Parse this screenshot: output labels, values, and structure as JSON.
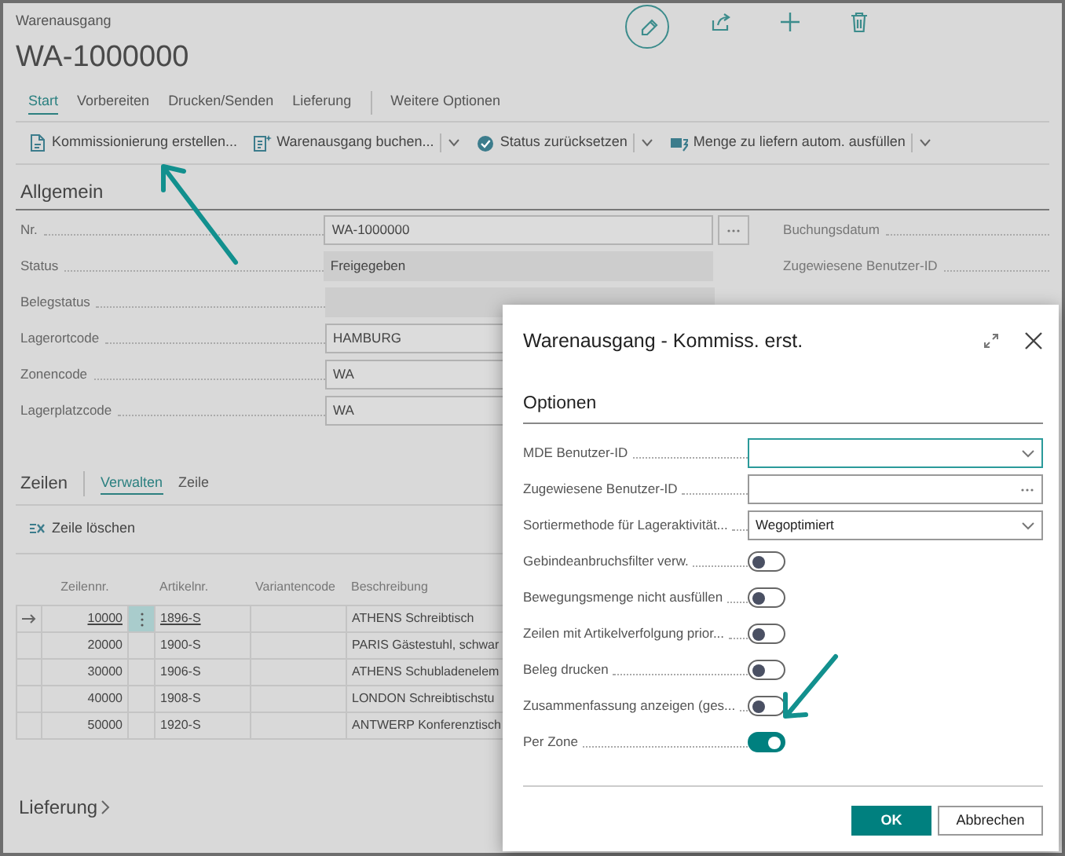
{
  "page": {
    "breadcrumb": "Warenausgang",
    "title": "WA-1000000"
  },
  "tabs": [
    {
      "label": "Start",
      "selected": true
    },
    {
      "label": "Vorbereiten",
      "selected": false
    },
    {
      "label": "Drucken/Senden",
      "selected": false
    },
    {
      "label": "Lieferung",
      "selected": false
    },
    {
      "label": "Weitere Optionen",
      "selected": false
    }
  ],
  "actions": [
    {
      "label": "Kommissionierung erstellen...",
      "dropdown": false
    },
    {
      "label": "Warenausgang buchen...",
      "dropdown": true
    },
    {
      "label": "Status zurücksetzen",
      "dropdown": true
    },
    {
      "label": "Menge zu liefern autom. ausfüllen",
      "dropdown": true
    }
  ],
  "general": {
    "heading": "Allgemein",
    "fields": [
      {
        "label": "Nr.",
        "value": "WA-1000000",
        "kind": "lookup"
      },
      {
        "label": "Status",
        "value": "Freigegeben",
        "kind": "readonly"
      },
      {
        "label": "Belegstatus",
        "kind": "readonly"
      },
      {
        "label": "Lagerortcode",
        "value": "HAMBURG",
        "kind": "input"
      },
      {
        "label": "Zonencode",
        "value": "WA",
        "kind": "input"
      },
      {
        "label": "Lagerplatzcode",
        "value": "WA",
        "kind": "input"
      }
    ],
    "right_fields": [
      {
        "label": "Buchungsdatum"
      },
      {
        "label": "Zugewiesene Benutzer-ID"
      }
    ]
  },
  "lines": {
    "heading": "Zeilen",
    "tabs": [
      {
        "label": "Verwalten",
        "selected": true
      },
      {
        "label": "Zeile",
        "selected": false
      }
    ],
    "action": "Zeile löschen",
    "columns": [
      "Zeilennr.",
      "Artikelnr.",
      "Variantencode",
      "Beschreibung"
    ],
    "rows": [
      {
        "line_no": "10000",
        "item_no": "1896-S",
        "description": "ATHENS Schreibtisch",
        "selected": true
      },
      {
        "line_no": "20000",
        "item_no": "1900-S",
        "description": "PARIS Gästestuhl, schwar",
        "selected": false
      },
      {
        "line_no": "30000",
        "item_no": "1906-S",
        "description": "ATHENS Schubladenelem",
        "selected": false
      },
      {
        "line_no": "40000",
        "item_no": "1908-S",
        "description": "LONDON Schreibtischstu",
        "selected": false
      },
      {
        "line_no": "50000",
        "item_no": "1920-S",
        "description": "ANTWERP Konferenztisch",
        "selected": false
      }
    ]
  },
  "delivery": {
    "heading": "Lieferung"
  },
  "dialog": {
    "title": "Warenausgang - Kommiss. erst.",
    "section": "Optionen",
    "fields": [
      {
        "label": "MDE Benutzer-ID",
        "kind": "dropdown",
        "focused": true
      },
      {
        "label": "Zugewiesene Benutzer-ID",
        "kind": "lookup",
        "focused": false
      },
      {
        "label": "Sortiermethode für Lageraktivität...",
        "kind": "dropdown",
        "value": "Wegoptimiert",
        "focused": false
      },
      {
        "label": "Gebindeanbruchsfilter verw.",
        "kind": "toggle",
        "on": false
      },
      {
        "label": "Bewegungsmenge nicht ausfüllen",
        "kind": "toggle",
        "on": false
      },
      {
        "label": "Zeilen mit Artikelverfolgung prior...",
        "kind": "toggle",
        "on": false
      },
      {
        "label": "Beleg drucken",
        "kind": "toggle",
        "on": false
      },
      {
        "label": "Zusammenfassung anzeigen (ges...",
        "kind": "toggle",
        "on": false
      },
      {
        "label": "Per Zone",
        "kind": "toggle",
        "on": true
      }
    ],
    "buttons": [
      {
        "label": "OK",
        "primary": true
      },
      {
        "label": "Abbrechen",
        "primary": false
      }
    ]
  }
}
